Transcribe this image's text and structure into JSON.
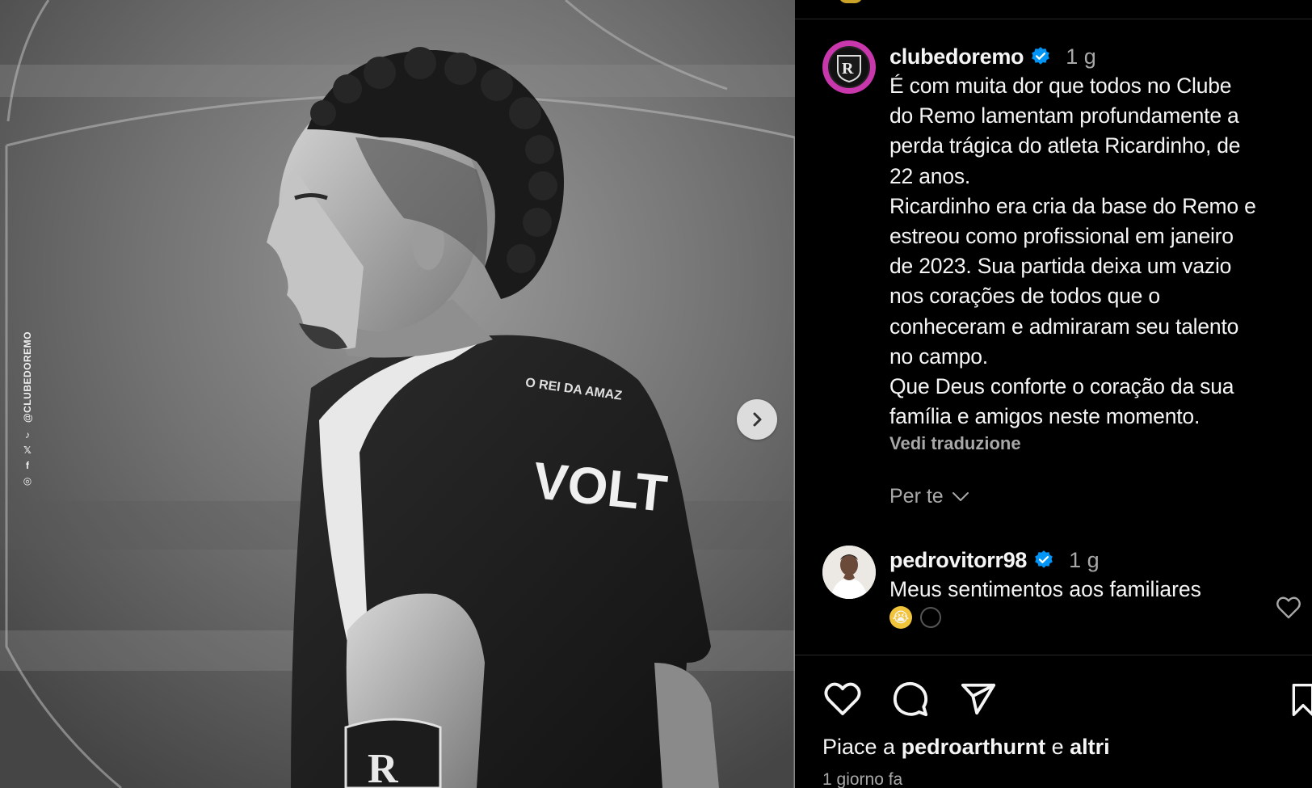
{
  "media": {
    "side_handle": "@CLUBEDOREMO",
    "side_icons": [
      "◎",
      "f",
      "𝕏",
      "♪"
    ],
    "shirt_sponsor": "VOLT",
    "shirt_text": "O REI DA AMAZ",
    "next_button_label": "›"
  },
  "post": {
    "author": "clubedoremo",
    "time": "1 g",
    "caption_lines": [
      "É com muita dor que todos no Clube",
      "do Remo lamentam profundamente a",
      "perda trágica do atleta Ricardinho, de",
      "22 anos.",
      "Ricardinho era cria da base do Remo e",
      "estreou como profissional em janeiro",
      "de 2023. Sua partida deixa um vazio",
      "nos corações de todos que o",
      "conheceram e admiraram seu talento",
      "no campo.",
      "Que Deus conforte o coração da sua",
      "família e amigos neste momento."
    ],
    "see_translation": "Vedi traduzione"
  },
  "filter": {
    "label": "Per te"
  },
  "comment": {
    "author": "pedrovitorr98",
    "time": "1 g",
    "text": "Meus sentimentos aos familiares",
    "emoji": "😭"
  },
  "footer": {
    "likes_prefix": "Piace a",
    "likes_user": "pedroarthurnt",
    "likes_conj": "e",
    "likes_others": "altri",
    "date": "1 giorno fa"
  },
  "colors": {
    "background": "#000000",
    "text_primary": "#f5f5f5",
    "text_secondary": "#a8a8a8",
    "verified": "#0095f6",
    "avatar_ring": "#c837ab"
  }
}
